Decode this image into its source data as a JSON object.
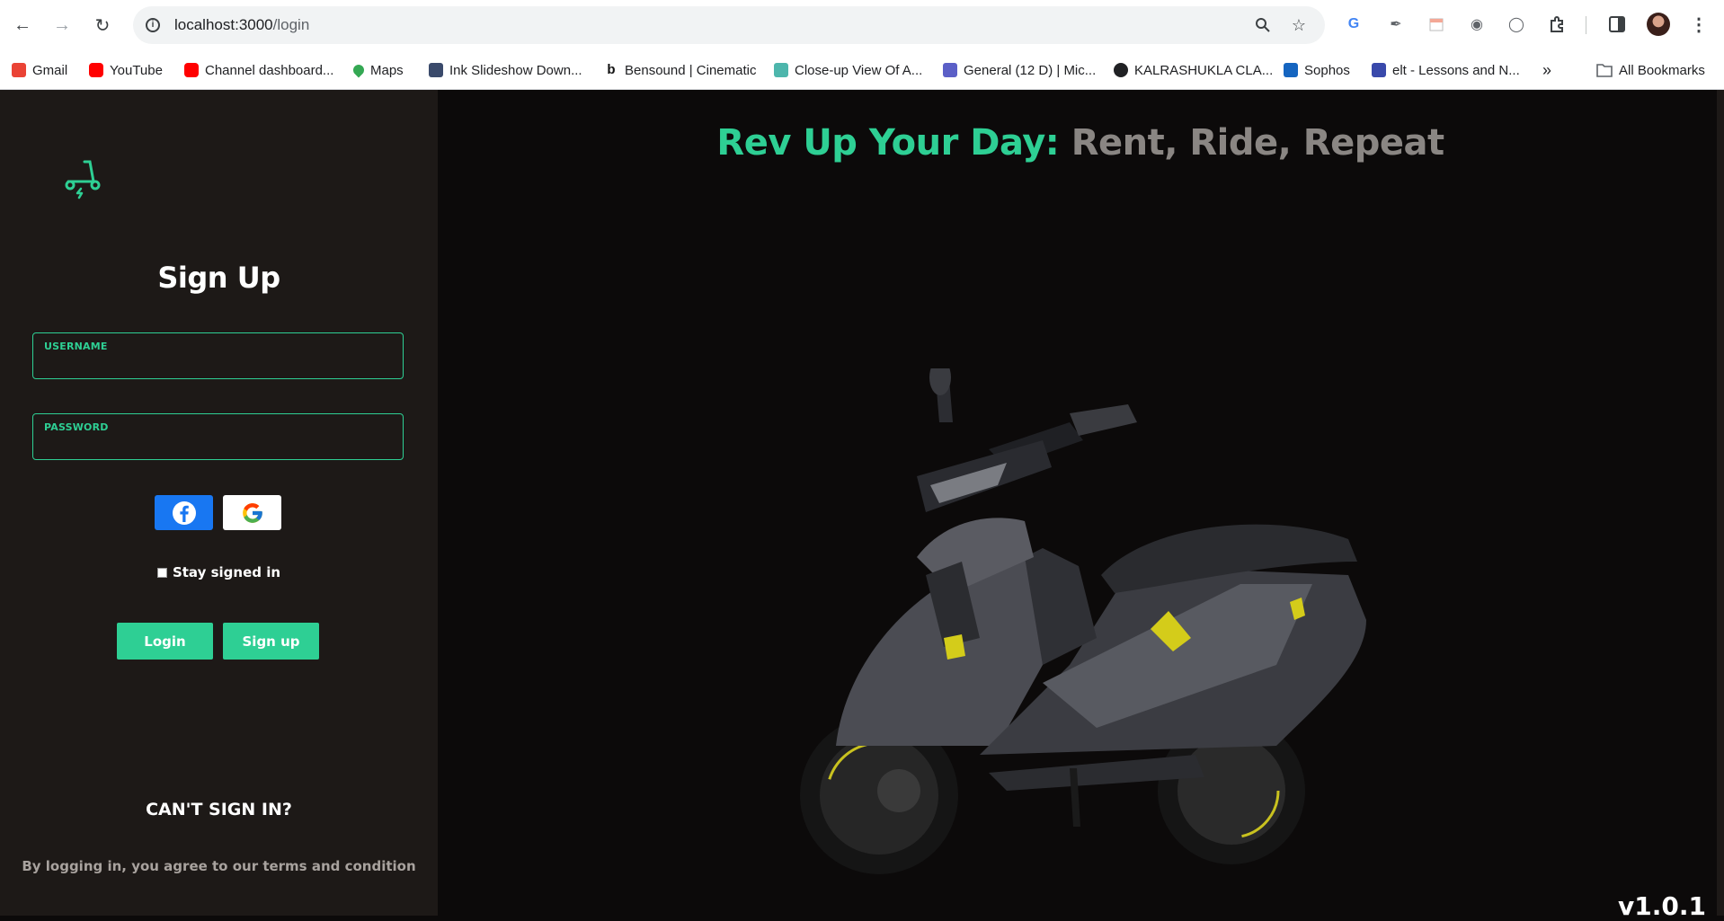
{
  "browser": {
    "url_host": "localhost:3000",
    "url_path": "/login",
    "bookmarks": [
      {
        "label": "Gmail",
        "color": "#ea4335"
      },
      {
        "label": "YouTube",
        "color": "#ff0000"
      },
      {
        "label": "Channel dashboard...",
        "color": "#ff0000"
      },
      {
        "label": "Maps",
        "color": "#34a853"
      },
      {
        "label": "Ink Slideshow Down...",
        "color": "#3a4a6b"
      },
      {
        "label": "Bensound | Cinematic",
        "color": "#111111"
      },
      {
        "label": "Close-up View Of A...",
        "color": "#4db6ac"
      },
      {
        "label": "General (12 D) | Mic...",
        "color": "#5b5fc7"
      },
      {
        "label": "KALRASHUKLA CLA...",
        "color": "#202124"
      },
      {
        "label": "Sophos",
        "color": "#1565c0"
      },
      {
        "label": "elt - Lessons and N...",
        "color": "#3949ab"
      }
    ],
    "more_bookmarks": "»",
    "all_bookmarks": "All Bookmarks"
  },
  "sidebar": {
    "title": "Sign Up",
    "username_label": "USERNAME",
    "password_label": "PASSWORD",
    "stay_signed_in": "Stay signed in",
    "login_button": "Login",
    "signup_button": "Sign up",
    "cant_sign_in": "CAN'T SIGN IN?",
    "terms": "By logging in, you agree to our terms and condition"
  },
  "hero": {
    "headline_accent": "Rev Up Your Day:",
    "headline_rest": "Rent, Ride, Repeat",
    "version": "v1.0.1"
  },
  "colors": {
    "accent": "#2ecf94",
    "sidebar_bg": "#1d1917",
    "page_bg": "#0c0a0a",
    "facebook": "#1877f2"
  }
}
